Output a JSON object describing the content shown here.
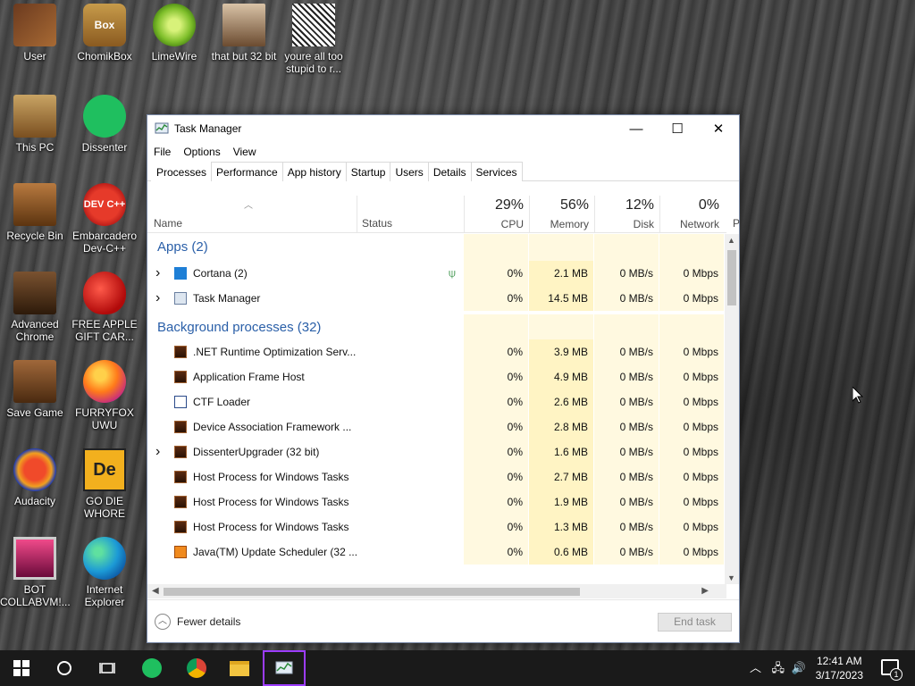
{
  "desktop": {
    "icons": [
      {
        "label": "User",
        "icon": "folder-user-icon"
      },
      {
        "label": "ChomikBox",
        "icon": "chomikbox-icon",
        "badge": "Box"
      },
      {
        "label": "LimeWire",
        "icon": "limewire-icon"
      },
      {
        "label": "that but 32 bit",
        "icon": "portrait-icon"
      },
      {
        "label": "youre all too stupid to r...",
        "icon": "sketch-icon"
      },
      {
        "label": "This PC",
        "icon": "this-pc-icon"
      },
      {
        "label": "Dissenter",
        "icon": "dissenter-icon"
      },
      {
        "label": "Recycle Bin",
        "icon": "recycle-bin-icon"
      },
      {
        "label": "Embarcadero Dev-C++",
        "icon": "devcpp-icon",
        "badge": "DEV C++"
      },
      {
        "label": "Advanced Chrome",
        "icon": "advanced-chrome-icon"
      },
      {
        "label": "FREE APPLE GIFT CAR...",
        "icon": "apple-icon"
      },
      {
        "label": "Save Game",
        "icon": "save-game-icon"
      },
      {
        "label": "FURRYFOX UWU",
        "icon": "firefox-icon"
      },
      {
        "label": "Audacity",
        "icon": "audacity-icon"
      },
      {
        "label": "GO DIE WHORE",
        "icon": "go-die-icon",
        "badge": "De"
      },
      {
        "label": "BOT COLLABVM!...",
        "icon": "bot-icon"
      },
      {
        "label": "Internet Explorer",
        "icon": "edge-icon"
      }
    ]
  },
  "taskmanager": {
    "title": "Task Manager",
    "window_buttons": {
      "minimize": "—",
      "maximize": "☐",
      "close": "✕"
    },
    "menu": [
      "File",
      "Options",
      "View"
    ],
    "tabs": [
      "Processes",
      "Performance",
      "App history",
      "Startup",
      "Users",
      "Details",
      "Services"
    ],
    "active_tab": "Processes",
    "columns": {
      "name": "Name",
      "status": "Status",
      "cpu": {
        "pct": "29%",
        "label": "CPU"
      },
      "memory": {
        "pct": "56%",
        "label": "Memory"
      },
      "disk": {
        "pct": "12%",
        "label": "Disk"
      },
      "network": {
        "pct": "0%",
        "label": "Network"
      },
      "power": "P"
    },
    "groups": {
      "apps": "Apps (2)",
      "background": "Background processes (32)"
    },
    "apps": [
      {
        "name": "Cortana (2)",
        "icon": "cortana-icon",
        "expandable": true,
        "status_icon": "leaf-icon",
        "cpu": "0%",
        "memory": "2.1 MB",
        "disk": "0 MB/s",
        "network": "0 Mbps"
      },
      {
        "name": "Task Manager",
        "icon": "taskmanager-icon",
        "expandable": true,
        "cpu": "0%",
        "memory": "14.5 MB",
        "disk": "0 MB/s",
        "network": "0 Mbps"
      }
    ],
    "background": [
      {
        "name": ".NET Runtime Optimization Serv...",
        "icon": "process-icon",
        "expandable": false,
        "cpu": "0%",
        "memory": "3.9 MB",
        "disk": "0 MB/s",
        "network": "0 Mbps"
      },
      {
        "name": "Application Frame Host",
        "icon": "process-icon",
        "expandable": false,
        "cpu": "0%",
        "memory": "4.9 MB",
        "disk": "0 MB/s",
        "network": "0 Mbps"
      },
      {
        "name": "CTF Loader",
        "icon": "ctf-icon",
        "expandable": false,
        "cpu": "0%",
        "memory": "2.6 MB",
        "disk": "0 MB/s",
        "network": "0 Mbps"
      },
      {
        "name": "Device Association Framework ...",
        "icon": "process-icon",
        "expandable": false,
        "cpu": "0%",
        "memory": "2.8 MB",
        "disk": "0 MB/s",
        "network": "0 Mbps"
      },
      {
        "name": "DissenterUpgrader (32 bit)",
        "icon": "process-icon",
        "expandable": true,
        "cpu": "0%",
        "memory": "1.6 MB",
        "disk": "0 MB/s",
        "network": "0 Mbps"
      },
      {
        "name": "Host Process for Windows Tasks",
        "icon": "process-icon",
        "expandable": false,
        "cpu": "0%",
        "memory": "2.7 MB",
        "disk": "0 MB/s",
        "network": "0 Mbps"
      },
      {
        "name": "Host Process for Windows Tasks",
        "icon": "process-icon",
        "expandable": false,
        "cpu": "0%",
        "memory": "1.9 MB",
        "disk": "0 MB/s",
        "network": "0 Mbps"
      },
      {
        "name": "Host Process for Windows Tasks",
        "icon": "process-icon",
        "expandable": false,
        "cpu": "0%",
        "memory": "1.3 MB",
        "disk": "0 MB/s",
        "network": "0 Mbps"
      },
      {
        "name": "Java(TM) Update Scheduler (32 ...",
        "icon": "java-icon",
        "expandable": false,
        "cpu": "0%",
        "memory": "0.6 MB",
        "disk": "0 MB/s",
        "network": "0 Mbps"
      }
    ],
    "footer": {
      "fewer_details": "Fewer details",
      "end_task": "End task"
    }
  },
  "taskbar": {
    "items": [
      "start-icon",
      "cortana-search-icon",
      "task-view-icon",
      "dissenter-icon",
      "chrome-icon",
      "file-explorer-icon",
      "taskmanager-icon"
    ],
    "clock": {
      "time": "12:41 AM",
      "date": "3/17/2023"
    },
    "notification_count": "1"
  },
  "colors": {
    "accent_blue": "#2a5fa8",
    "heat_yellow": "#fff4c4",
    "taskbar": "#1a1a1a",
    "active_app_border": "#9c3cff"
  }
}
